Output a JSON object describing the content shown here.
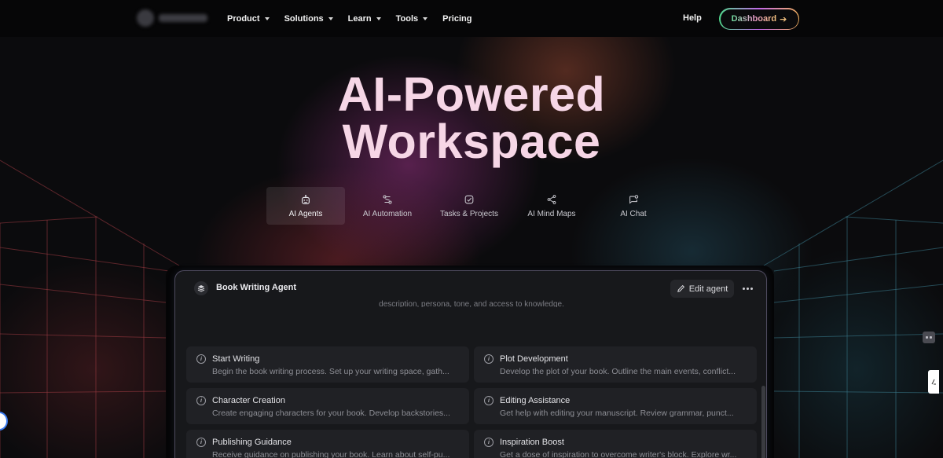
{
  "nav": {
    "menu": [
      {
        "label": "Product",
        "has_dropdown": true
      },
      {
        "label": "Solutions",
        "has_dropdown": true
      },
      {
        "label": "Learn",
        "has_dropdown": true
      },
      {
        "label": "Tools",
        "has_dropdown": true
      },
      {
        "label": "Pricing",
        "has_dropdown": false
      }
    ],
    "help": "Help",
    "dashboard": {
      "label": "Dashboard",
      "arrow": "➔"
    }
  },
  "hero": {
    "line1": "AI-Powered",
    "line2": "Workspace"
  },
  "tabs": [
    {
      "label": "AI Agents",
      "icon": "robot-icon",
      "active": true
    },
    {
      "label": "AI Automation",
      "icon": "automation-icon",
      "active": false
    },
    {
      "label": "Tasks & Projects",
      "icon": "tasks-icon",
      "active": false
    },
    {
      "label": "AI Mind Maps",
      "icon": "mind-map-icon",
      "active": false
    },
    {
      "label": "AI Chat",
      "icon": "chat-icon",
      "active": false
    }
  ],
  "agent_panel": {
    "title": "Book Writing Agent",
    "edit_label": "Edit agent",
    "partial_description": "description, persona, tone, and access to knowledge.",
    "cards": [
      {
        "title": "Start Writing",
        "desc": "Begin the book writing process. Set up your writing space, gath..."
      },
      {
        "title": "Plot Development",
        "desc": "Develop the plot of your book. Outline the main events, conflict..."
      },
      {
        "title": "Character Creation",
        "desc": "Create engaging characters for your book. Develop backstories..."
      },
      {
        "title": "Editing Assistance",
        "desc": "Get help with editing your manuscript. Review grammar, punct..."
      },
      {
        "title": "Publishing Guidance",
        "desc": "Receive guidance on publishing your book. Learn about self-pu..."
      },
      {
        "title": "Inspiration Boost",
        "desc": "Get a dose of inspiration to overcome writer's block. Explore wr..."
      }
    ]
  },
  "colors": {
    "background": "#0b0b0d",
    "hero_text": "#f6d6e6",
    "panel": "#17181b",
    "card": "#202125"
  }
}
